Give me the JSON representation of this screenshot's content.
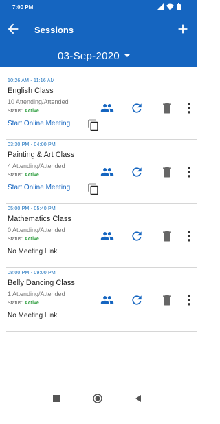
{
  "status_bar": {
    "time": "7:00 PM"
  },
  "app_bar": {
    "title": "Sessions",
    "date": "03-Sep-2020"
  },
  "colors": {
    "primary": "#1565c0",
    "active_green": "#2e9e3f",
    "time_blue": "#1e73be"
  },
  "sessions": [
    {
      "time": "10:26 AM - 11:16 AM",
      "name": "English Class",
      "attendance": "10 Attending/Attended",
      "status_label": "Status:",
      "status": "Active",
      "meeting": "Start Online Meeting",
      "has_copy": true
    },
    {
      "time": "03:30 PM - 04:00 PM",
      "name": "Painting & Art Class",
      "attendance": "4 Attending/Attended",
      "status_label": "Status:",
      "status": "Active",
      "meeting": "Start Online Meeting",
      "has_copy": true
    },
    {
      "time": "05:00 PM - 05:40 PM",
      "name": "Mathematics Class",
      "attendance": "0 Attending/Attended",
      "status_label": "Status:",
      "status": "Active",
      "meeting": "No Meeting Link",
      "has_copy": false
    },
    {
      "time": "08:00 PM - 09:00 PM",
      "name": "Belly Dancing Class",
      "attendance": "1 Attending/Attended",
      "status_label": "Status:",
      "status": "Active",
      "meeting": "No Meeting Link",
      "has_copy": false
    }
  ],
  "icons": {
    "back": "arrow-back-icon",
    "add": "plus-icon",
    "dropdown": "caret-down-icon",
    "attendees": "people-icon",
    "refresh": "refresh-icon",
    "delete": "trash-icon",
    "more": "more-vert-icon",
    "copy": "copy-icon"
  }
}
